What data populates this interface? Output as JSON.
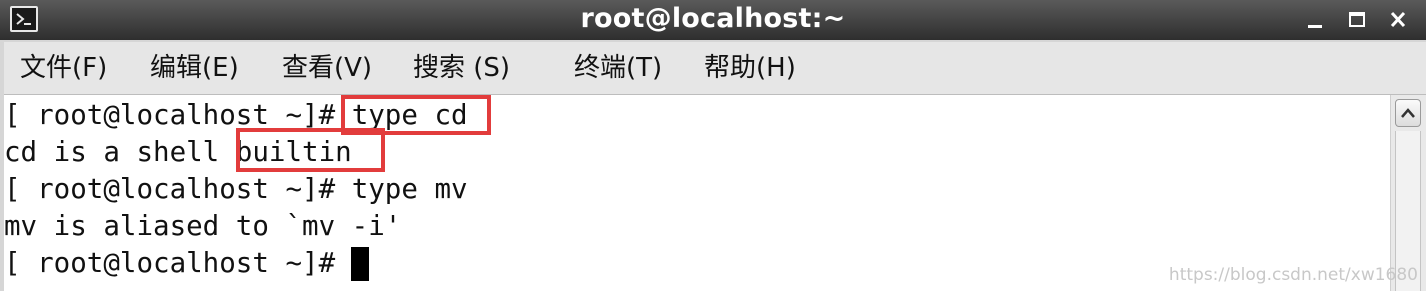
{
  "window": {
    "title": "root@localhost:~"
  },
  "menubar": {
    "items": [
      {
        "label": "文件(F)"
      },
      {
        "label": "编辑(E)"
      },
      {
        "label": "查看(V)"
      },
      {
        "label": "搜索 (S)"
      },
      {
        "label": "终端(T)"
      },
      {
        "label": "帮助(H)"
      }
    ]
  },
  "terminal": {
    "lines": [
      {
        "prompt": "[ root@localhost ~]# ",
        "text": "type cd"
      },
      {
        "text": "cd is a shell builtin"
      },
      {
        "prompt": "[ root@localhost ~]# ",
        "text": "type mv"
      },
      {
        "text": "mv is aliased to `mv -i'"
      },
      {
        "prompt": "[ root@localhost ~]# ",
        "text": ""
      }
    ]
  },
  "annotations": {
    "color": "#e23c3c"
  },
  "icons": {
    "app": "terminal-icon",
    "minimize": "minimize-icon",
    "maximize": "maximize-icon",
    "close": "close-icon",
    "scroll_up": "chevron-up-icon"
  },
  "watermark": "https://blog.csdn.net/xw1680"
}
